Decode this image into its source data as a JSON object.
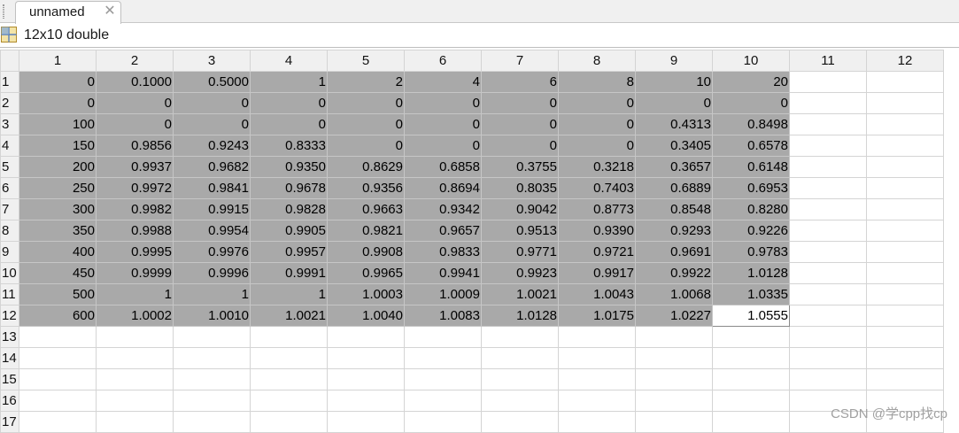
{
  "tab": {
    "title": "unnamed",
    "close_glyph": "✕"
  },
  "info": {
    "size_label": "12x10 double",
    "icon": "table-grid-icon"
  },
  "columns": [
    "1",
    "2",
    "3",
    "4",
    "5",
    "6",
    "7",
    "8",
    "9",
    "10",
    "11",
    "12"
  ],
  "rows": [
    {
      "label": "1",
      "cells": [
        "0",
        "0.1000",
        "0.5000",
        "1",
        "2",
        "4",
        "6",
        "8",
        "10",
        "20",
        "",
        ""
      ]
    },
    {
      "label": "2",
      "cells": [
        "0",
        "0",
        "0",
        "0",
        "0",
        "0",
        "0",
        "0",
        "0",
        "0",
        "",
        ""
      ]
    },
    {
      "label": "3",
      "cells": [
        "100",
        "0",
        "0",
        "0",
        "0",
        "0",
        "0",
        "0",
        "0.4313",
        "0.8498",
        "",
        ""
      ]
    },
    {
      "label": "4",
      "cells": [
        "150",
        "0.9856",
        "0.9243",
        "0.8333",
        "0",
        "0",
        "0",
        "0",
        "0.3405",
        "0.6578",
        "",
        ""
      ]
    },
    {
      "label": "5",
      "cells": [
        "200",
        "0.9937",
        "0.9682",
        "0.9350",
        "0.8629",
        "0.6858",
        "0.3755",
        "0.3218",
        "0.3657",
        "0.6148",
        "",
        ""
      ]
    },
    {
      "label": "6",
      "cells": [
        "250",
        "0.9972",
        "0.9841",
        "0.9678",
        "0.9356",
        "0.8694",
        "0.8035",
        "0.7403",
        "0.6889",
        "0.6953",
        "",
        ""
      ]
    },
    {
      "label": "7",
      "cells": [
        "300",
        "0.9982",
        "0.9915",
        "0.9828",
        "0.9663",
        "0.9342",
        "0.9042",
        "0.8773",
        "0.8548",
        "0.8280",
        "",
        ""
      ]
    },
    {
      "label": "8",
      "cells": [
        "350",
        "0.9988",
        "0.9954",
        "0.9905",
        "0.9821",
        "0.9657",
        "0.9513",
        "0.9390",
        "0.9293",
        "0.9226",
        "",
        ""
      ]
    },
    {
      "label": "9",
      "cells": [
        "400",
        "0.9995",
        "0.9976",
        "0.9957",
        "0.9908",
        "0.9833",
        "0.9771",
        "0.9721",
        "0.9691",
        "0.9783",
        "",
        ""
      ]
    },
    {
      "label": "10",
      "cells": [
        "450",
        "0.9999",
        "0.9996",
        "0.9991",
        "0.9965",
        "0.9941",
        "0.9923",
        "0.9917",
        "0.9922",
        "1.0128",
        "",
        ""
      ]
    },
    {
      "label": "11",
      "cells": [
        "500",
        "1",
        "1",
        "1",
        "1.0003",
        "1.0009",
        "1.0021",
        "1.0043",
        "1.0068",
        "1.0335",
        "",
        ""
      ]
    },
    {
      "label": "12",
      "cells": [
        "600",
        "1.0002",
        "1.0010",
        "1.0021",
        "1.0040",
        "1.0083",
        "1.0128",
        "1.0175",
        "1.0227",
        "1.0555",
        "",
        ""
      ]
    },
    {
      "label": "13",
      "cells": [
        "",
        "",
        "",
        "",
        "",
        "",
        "",
        "",
        "",
        "",
        "",
        ""
      ]
    },
    {
      "label": "14",
      "cells": [
        "",
        "",
        "",
        "",
        "",
        "",
        "",
        "",
        "",
        "",
        "",
        ""
      ]
    },
    {
      "label": "15",
      "cells": [
        "",
        "",
        "",
        "",
        "",
        "",
        "",
        "",
        "",
        "",
        "",
        ""
      ]
    },
    {
      "label": "16",
      "cells": [
        "",
        "",
        "",
        "",
        "",
        "",
        "",
        "",
        "",
        "",
        "",
        ""
      ]
    },
    {
      "label": "17",
      "cells": [
        "",
        "",
        "",
        "",
        "",
        "",
        "",
        "",
        "",
        "",
        "",
        ""
      ]
    }
  ],
  "selection": {
    "rows": 12,
    "cols": 10,
    "active_row": 12,
    "active_col": 10
  },
  "watermark": "CSDN @学cpp找cp"
}
